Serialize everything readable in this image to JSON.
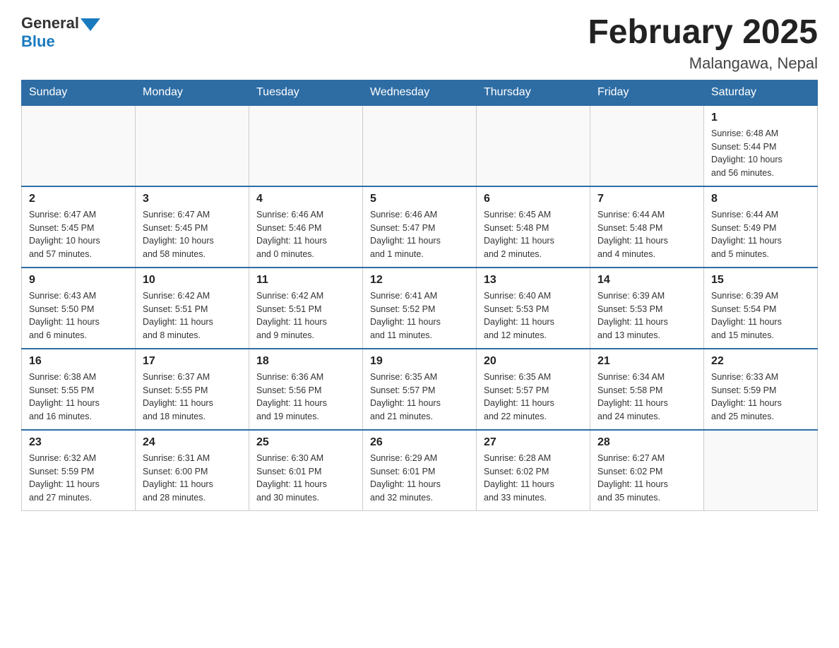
{
  "logo": {
    "text_general": "General",
    "text_blue": "Blue"
  },
  "title": {
    "month_year": "February 2025",
    "location": "Malangawa, Nepal"
  },
  "days_of_week": [
    "Sunday",
    "Monday",
    "Tuesday",
    "Wednesday",
    "Thursday",
    "Friday",
    "Saturday"
  ],
  "weeks": [
    {
      "days": [
        {
          "number": "",
          "info": ""
        },
        {
          "number": "",
          "info": ""
        },
        {
          "number": "",
          "info": ""
        },
        {
          "number": "",
          "info": ""
        },
        {
          "number": "",
          "info": ""
        },
        {
          "number": "",
          "info": ""
        },
        {
          "number": "1",
          "info": "Sunrise: 6:48 AM\nSunset: 5:44 PM\nDaylight: 10 hours\nand 56 minutes."
        }
      ]
    },
    {
      "days": [
        {
          "number": "2",
          "info": "Sunrise: 6:47 AM\nSunset: 5:45 PM\nDaylight: 10 hours\nand 57 minutes."
        },
        {
          "number": "3",
          "info": "Sunrise: 6:47 AM\nSunset: 5:45 PM\nDaylight: 10 hours\nand 58 minutes."
        },
        {
          "number": "4",
          "info": "Sunrise: 6:46 AM\nSunset: 5:46 PM\nDaylight: 11 hours\nand 0 minutes."
        },
        {
          "number": "5",
          "info": "Sunrise: 6:46 AM\nSunset: 5:47 PM\nDaylight: 11 hours\nand 1 minute."
        },
        {
          "number": "6",
          "info": "Sunrise: 6:45 AM\nSunset: 5:48 PM\nDaylight: 11 hours\nand 2 minutes."
        },
        {
          "number": "7",
          "info": "Sunrise: 6:44 AM\nSunset: 5:48 PM\nDaylight: 11 hours\nand 4 minutes."
        },
        {
          "number": "8",
          "info": "Sunrise: 6:44 AM\nSunset: 5:49 PM\nDaylight: 11 hours\nand 5 minutes."
        }
      ]
    },
    {
      "days": [
        {
          "number": "9",
          "info": "Sunrise: 6:43 AM\nSunset: 5:50 PM\nDaylight: 11 hours\nand 6 minutes."
        },
        {
          "number": "10",
          "info": "Sunrise: 6:42 AM\nSunset: 5:51 PM\nDaylight: 11 hours\nand 8 minutes."
        },
        {
          "number": "11",
          "info": "Sunrise: 6:42 AM\nSunset: 5:51 PM\nDaylight: 11 hours\nand 9 minutes."
        },
        {
          "number": "12",
          "info": "Sunrise: 6:41 AM\nSunset: 5:52 PM\nDaylight: 11 hours\nand 11 minutes."
        },
        {
          "number": "13",
          "info": "Sunrise: 6:40 AM\nSunset: 5:53 PM\nDaylight: 11 hours\nand 12 minutes."
        },
        {
          "number": "14",
          "info": "Sunrise: 6:39 AM\nSunset: 5:53 PM\nDaylight: 11 hours\nand 13 minutes."
        },
        {
          "number": "15",
          "info": "Sunrise: 6:39 AM\nSunset: 5:54 PM\nDaylight: 11 hours\nand 15 minutes."
        }
      ]
    },
    {
      "days": [
        {
          "number": "16",
          "info": "Sunrise: 6:38 AM\nSunset: 5:55 PM\nDaylight: 11 hours\nand 16 minutes."
        },
        {
          "number": "17",
          "info": "Sunrise: 6:37 AM\nSunset: 5:55 PM\nDaylight: 11 hours\nand 18 minutes."
        },
        {
          "number": "18",
          "info": "Sunrise: 6:36 AM\nSunset: 5:56 PM\nDaylight: 11 hours\nand 19 minutes."
        },
        {
          "number": "19",
          "info": "Sunrise: 6:35 AM\nSunset: 5:57 PM\nDaylight: 11 hours\nand 21 minutes."
        },
        {
          "number": "20",
          "info": "Sunrise: 6:35 AM\nSunset: 5:57 PM\nDaylight: 11 hours\nand 22 minutes."
        },
        {
          "number": "21",
          "info": "Sunrise: 6:34 AM\nSunset: 5:58 PM\nDaylight: 11 hours\nand 24 minutes."
        },
        {
          "number": "22",
          "info": "Sunrise: 6:33 AM\nSunset: 5:59 PM\nDaylight: 11 hours\nand 25 minutes."
        }
      ]
    },
    {
      "days": [
        {
          "number": "23",
          "info": "Sunrise: 6:32 AM\nSunset: 5:59 PM\nDaylight: 11 hours\nand 27 minutes."
        },
        {
          "number": "24",
          "info": "Sunrise: 6:31 AM\nSunset: 6:00 PM\nDaylight: 11 hours\nand 28 minutes."
        },
        {
          "number": "25",
          "info": "Sunrise: 6:30 AM\nSunset: 6:01 PM\nDaylight: 11 hours\nand 30 minutes."
        },
        {
          "number": "26",
          "info": "Sunrise: 6:29 AM\nSunset: 6:01 PM\nDaylight: 11 hours\nand 32 minutes."
        },
        {
          "number": "27",
          "info": "Sunrise: 6:28 AM\nSunset: 6:02 PM\nDaylight: 11 hours\nand 33 minutes."
        },
        {
          "number": "28",
          "info": "Sunrise: 6:27 AM\nSunset: 6:02 PM\nDaylight: 11 hours\nand 35 minutes."
        },
        {
          "number": "",
          "info": ""
        }
      ]
    }
  ]
}
